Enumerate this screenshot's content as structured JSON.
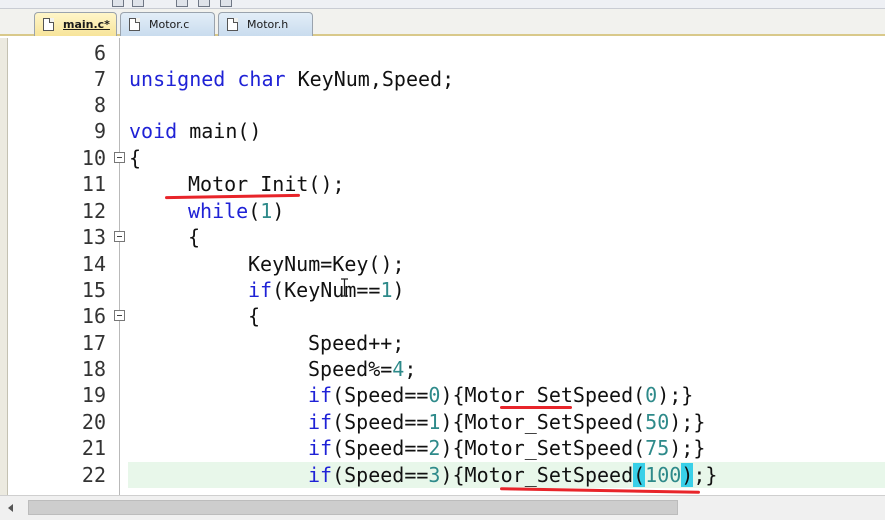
{
  "tabs": [
    {
      "label": "main.c*",
      "active": true
    },
    {
      "label": "Motor.c",
      "active": false
    },
    {
      "label": "Motor.h",
      "active": false
    }
  ],
  "editor": {
    "current_line": "22",
    "lines": [
      {
        "num": "6",
        "code": ""
      },
      {
        "num": "7",
        "code": "unsigned char KeyNum,Speed;"
      },
      {
        "num": "8",
        "code": ""
      },
      {
        "num": "9",
        "code": "void main()"
      },
      {
        "num": "10",
        "code": "{"
      },
      {
        "num": "11",
        "code": "Motor_Init();"
      },
      {
        "num": "12",
        "code": "while(1)"
      },
      {
        "num": "13",
        "code": "{"
      },
      {
        "num": "14",
        "code": "KeyNum=Key();"
      },
      {
        "num": "15",
        "code": "if(KeyNum==1)"
      },
      {
        "num": "16",
        "code": "{"
      },
      {
        "num": "17",
        "code": "Speed++;"
      },
      {
        "num": "18",
        "code": "Speed%=4;"
      },
      {
        "num": "19",
        "code": "if(Speed==0){Motor_SetSpeed(0);}"
      },
      {
        "num": "20",
        "code": "if(Speed==1){Motor_SetSpeed(50);}"
      },
      {
        "num": "21",
        "code": "if(Speed==2){Motor_SetSpeed(75);}"
      },
      {
        "num": "22",
        "code": "if(Speed==3){Motor_SetSpeed(100);}"
      }
    ]
  },
  "colors": {
    "keyword": "#1f22d6",
    "number": "#2e8a8a",
    "current_line_bg": "#e8f7ea",
    "annotation_red": "#e8242a",
    "brace_highlight": "#39d0e8"
  },
  "icons": [
    "file-icon",
    "fold-collapse-icon",
    "text-cursor-icon",
    "scroll-left-arrow-icon"
  ]
}
